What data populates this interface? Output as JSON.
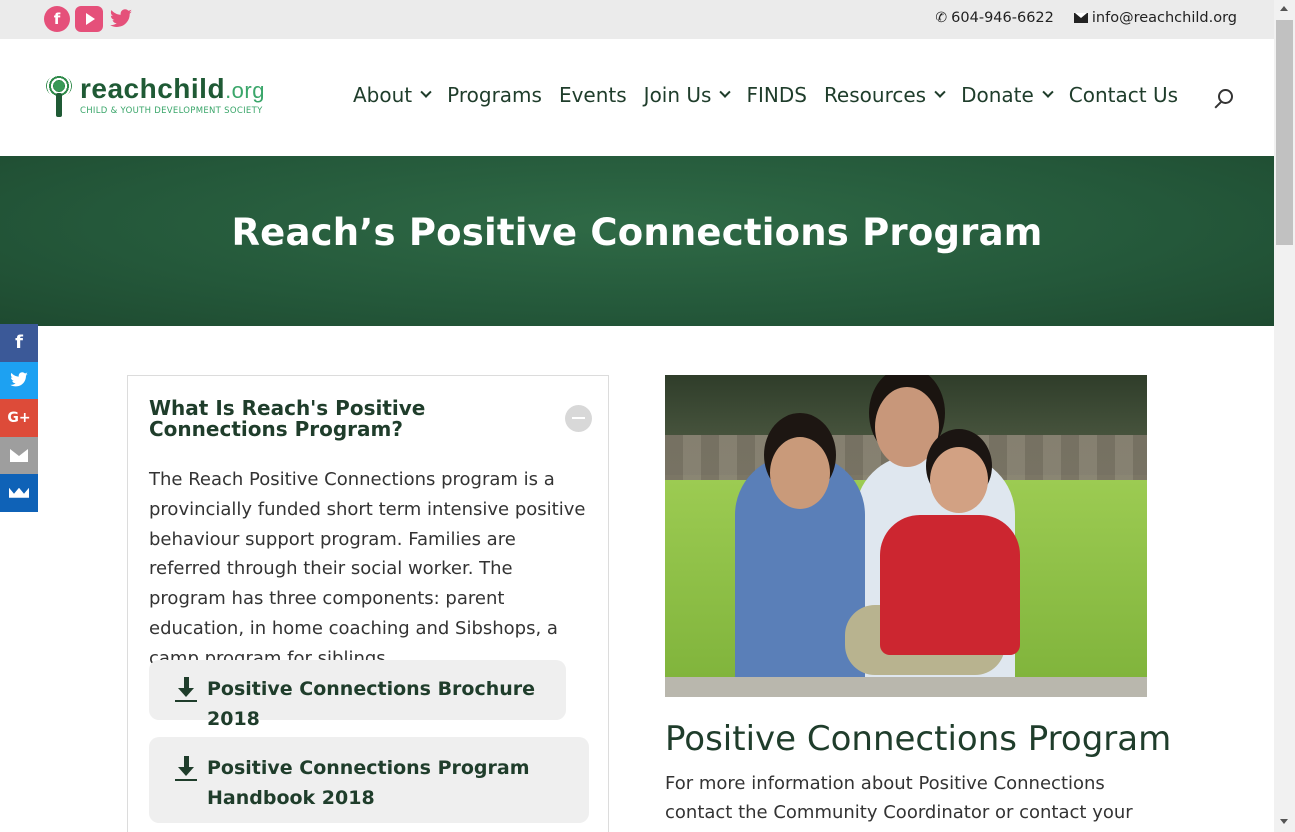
{
  "topbar": {
    "social": [
      {
        "icon": "facebook-icon",
        "glyph": "f"
      },
      {
        "icon": "youtube-icon"
      },
      {
        "icon": "twitter-icon",
        "glyph": "✒"
      }
    ],
    "phone": "604-946-6622",
    "email": "info@reachchild.org"
  },
  "logo": {
    "reach": "reach",
    "child": "child",
    "org": ".org",
    "tagline": "CHILD & YOUTH DEVELOPMENT SOCIETY"
  },
  "nav": {
    "items": [
      {
        "label": "About"
      },
      {
        "label": "Programs"
      },
      {
        "label": "Events"
      },
      {
        "label": "Join Us"
      },
      {
        "label": "FINDS"
      },
      {
        "label": "Resources"
      },
      {
        "label": "Donate"
      },
      {
        "label": "Contact Us"
      }
    ]
  },
  "hero": {
    "title": "Reach’s Positive Connections Program"
  },
  "side_share": {
    "facebook": "f",
    "twitter": "✦",
    "googleplus": "G+"
  },
  "accordion": {
    "title": "What Is Reach's Positive Connections Program?",
    "body": "The Reach Positive Connections program is a provincially funded short term intensive positive behaviour support program. Families are referred through their social worker. The program has three components: parent education, in home coaching and Sibshops, a camp program for siblings.",
    "downloads": [
      {
        "label": "Positive Connections Brochure 2018"
      },
      {
        "label": "Positive Connections Program Handbook 2018"
      }
    ]
  },
  "right": {
    "title": "Positive Connections Program",
    "text": "For more information about Positive Connections contact the Community Coordinator or contact your MCFD CYSN"
  },
  "colors": {
    "brand_green": "#1f5a35",
    "hero_green": "#2a5e3f",
    "social_pink": "#e5507a"
  }
}
